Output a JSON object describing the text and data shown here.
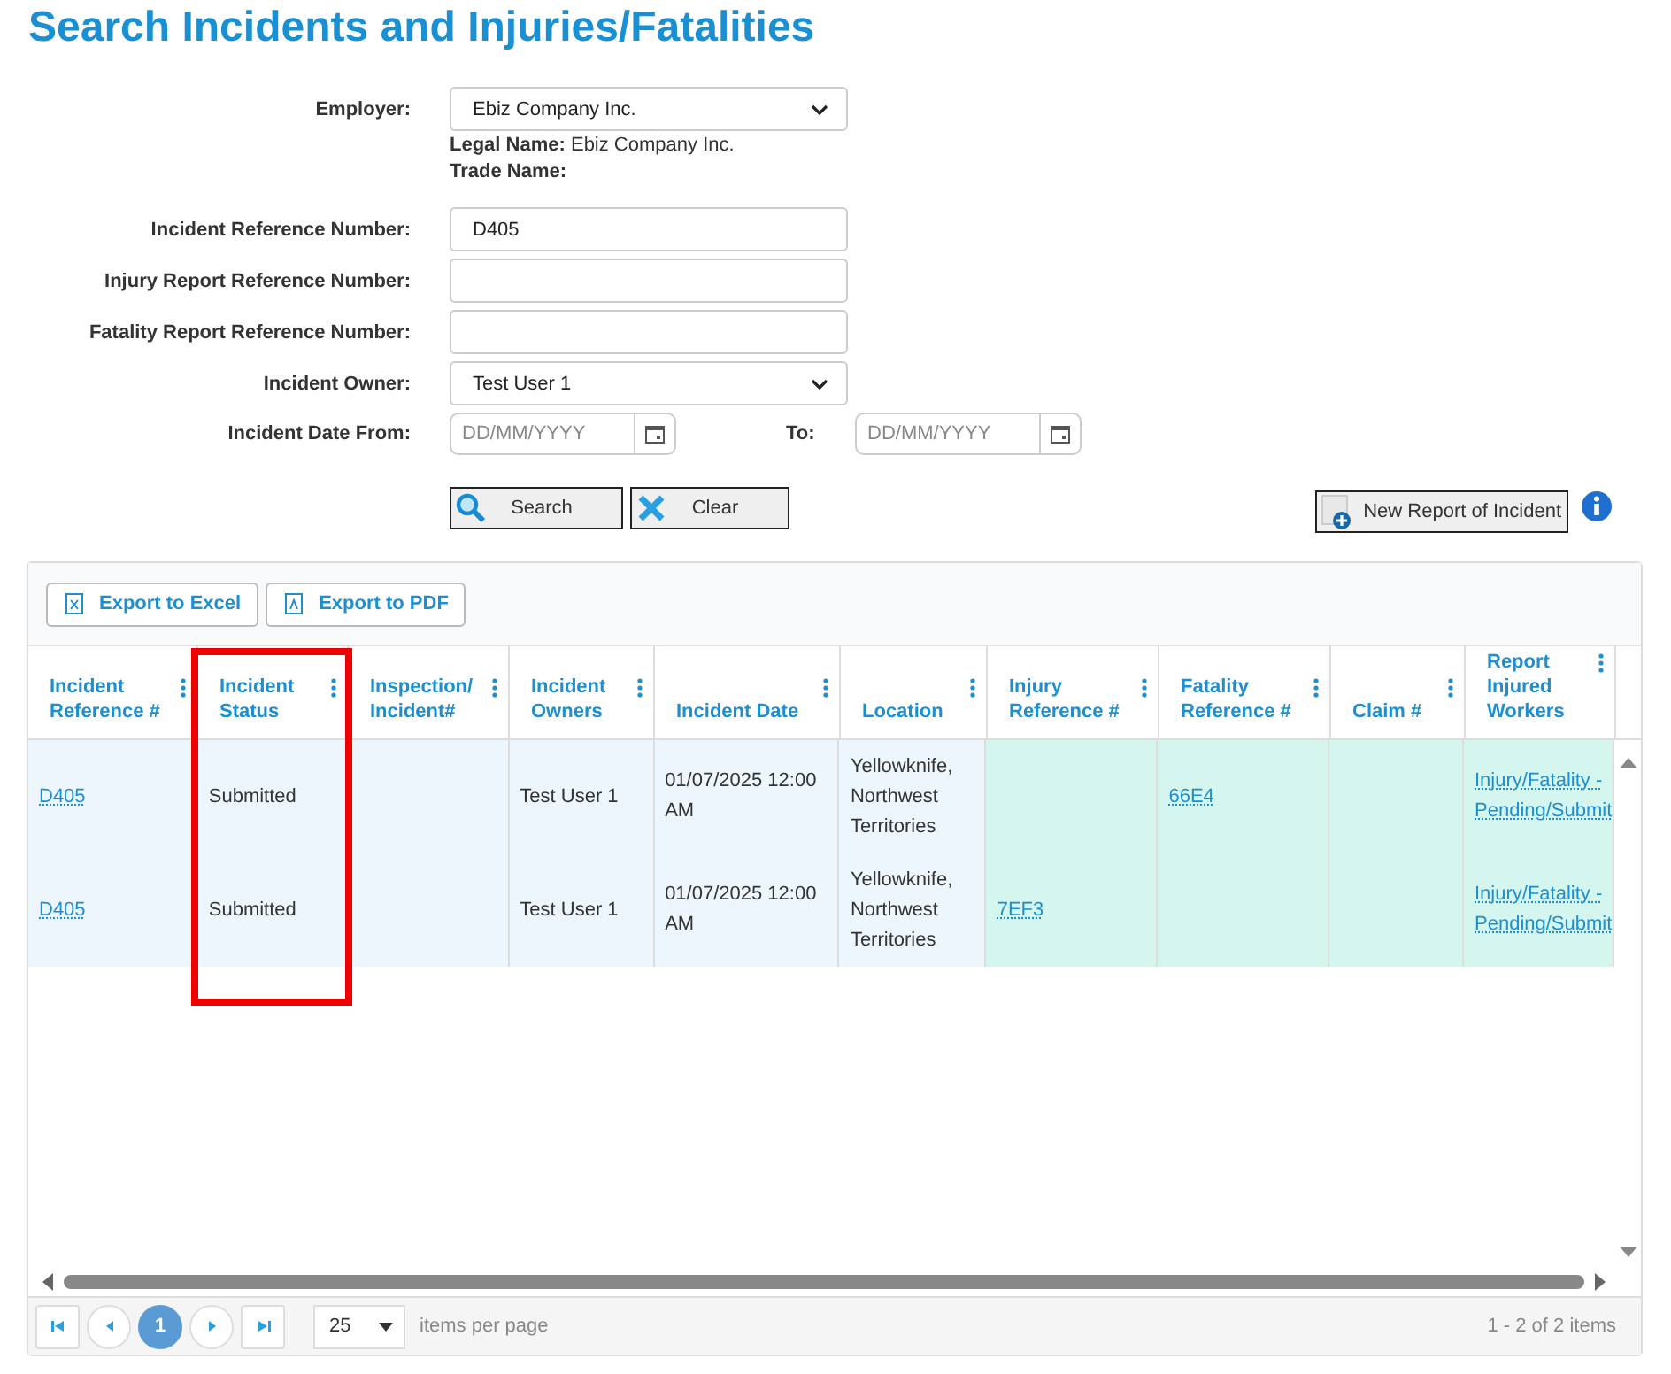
{
  "page_title": "Search Incidents and Injuries/Fatalities",
  "form": {
    "employer": {
      "label": "Employer:",
      "value": "Ebiz Company Inc."
    },
    "legal_name": {
      "label": "Legal Name:",
      "value": "Ebiz Company Inc."
    },
    "trade_name": {
      "label": "Trade Name:"
    },
    "text_fields": [
      {
        "label": "Incident Reference Number:",
        "value": "D405"
      },
      {
        "label": "Injury Report Reference Number:"
      },
      {
        "label": "Fatality Report Reference Number:"
      }
    ],
    "owner": {
      "label": "Incident Owner:",
      "value": "Test User 1"
    },
    "date_from": {
      "label": "Incident Date From:",
      "placeholder": "DD/MM/YYYY"
    },
    "date_to": {
      "label": "To:",
      "placeholder": "DD/MM/YYYY"
    },
    "buttons": [
      "Search",
      "Clear"
    ],
    "new_report_button": "New Report of Incident"
  },
  "grid": {
    "toolbar": [
      "Export to Excel",
      "Export to PDF"
    ],
    "columns": [
      {
        "title": "Incident Reference #",
        "kind": "link",
        "tinted": false,
        "highlighted": false
      },
      {
        "title": "Incident Status",
        "kind": "text",
        "tinted": false,
        "highlighted": true
      },
      {
        "title": "Inspection/ Incident#",
        "kind": "text",
        "tinted": false,
        "highlighted": false
      },
      {
        "title": "Incident Owners",
        "kind": "text",
        "tinted": false,
        "highlighted": false
      },
      {
        "title": "Incident Date",
        "kind": "text",
        "tinted": false,
        "highlighted": false
      },
      {
        "title": "Location",
        "kind": "text",
        "tinted": false,
        "highlighted": false
      },
      {
        "title": "Injury Reference #",
        "kind": "link",
        "tinted": true,
        "highlighted": false
      },
      {
        "title": "Fatality Reference #",
        "kind": "link",
        "tinted": true,
        "highlighted": false
      },
      {
        "title": "Claim #",
        "kind": "text",
        "tinted": true,
        "highlighted": false
      },
      {
        "title": "Report Injured Workers",
        "kind": "link",
        "tinted": true,
        "highlighted": false
      }
    ],
    "rows": [
      [
        "D405",
        "Submitted",
        null,
        "Test User 1",
        "01/07/2025 12:00 AM",
        "Yellowknife, Northwest Territories",
        null,
        "66E4",
        null,
        "Injury/Fatality - Pending/Submit"
      ],
      [
        "D405",
        "Submitted",
        null,
        "Test User 1",
        "01/07/2025 12:00 AM",
        "Yellowknife, Northwest Territories",
        "7EF3",
        null,
        null,
        "Injury/Fatality - Pending/Submit"
      ]
    ],
    "pager": {
      "pages": [
        {
          "label": "1",
          "selected": true
        }
      ],
      "page_size": "25",
      "page_size_label": "items per page",
      "summary": "1 - 2 of 2 items"
    }
  }
}
